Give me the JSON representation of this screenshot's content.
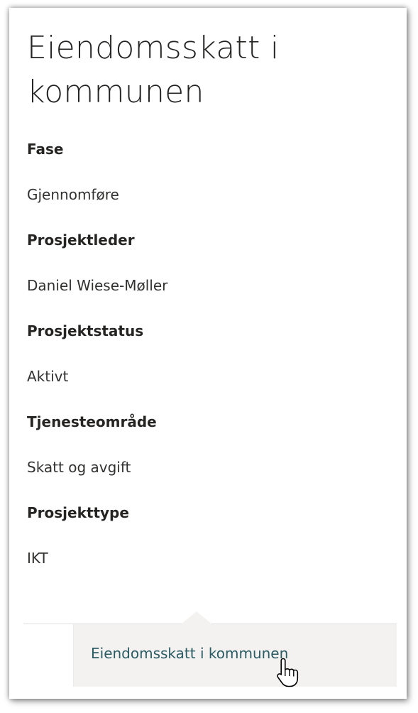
{
  "title": "Eiendomsskatt i kommunen",
  "fields": [
    {
      "label": "Fase",
      "value": "Gjennomføre"
    },
    {
      "label": "Prosjektleder",
      "value": "Daniel Wiese-Møller"
    },
    {
      "label": "Prosjektstatus",
      "value": "Aktivt"
    },
    {
      "label": "Tjenesteområde",
      "value": "Skatt og avgift"
    },
    {
      "label": "Prosjekttype",
      "value": "IKT"
    }
  ],
  "footer": {
    "link_label": "Eiendomsskatt i kommunen"
  },
  "icons": {
    "cursor": "hand-pointer-icon"
  },
  "colors": {
    "link": "#2b5b63",
    "footer_bg": "#f3f2f1"
  }
}
